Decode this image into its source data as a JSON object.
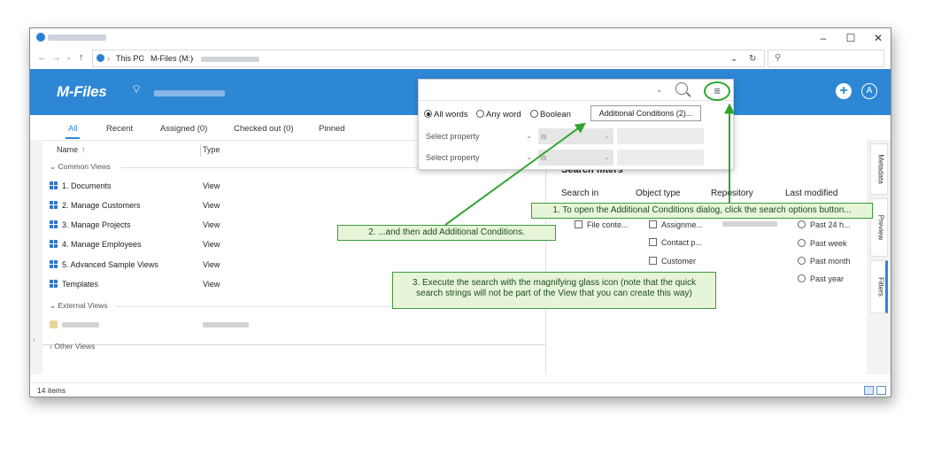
{
  "window": {
    "controls": {
      "minimize": "–",
      "maximize": "☐",
      "close": "✕"
    }
  },
  "address": {
    "back": "←",
    "forward": "→",
    "recent": "⌄",
    "up": "↑",
    "crumbs": [
      "This PC",
      "M-Files (M:)"
    ],
    "sep": "›",
    "dropdown": "⌄",
    "refresh": "↻",
    "search_glyph": "⚲"
  },
  "header": {
    "logo": "M-Files",
    "wifi_icon": "⌔",
    "plus": "+",
    "user": "A"
  },
  "search": {
    "caret": "⌄",
    "options_glyph": "≡",
    "modes": [
      {
        "label": "All words",
        "selected": true
      },
      {
        "label": "Any word",
        "selected": false
      },
      {
        "label": "Boolean",
        "selected": false
      }
    ],
    "additional_conditions": "Additional Conditions (2)...",
    "conditions": [
      {
        "property": "Select property",
        "operator": "is"
      },
      {
        "property": "Select property",
        "operator": "is"
      }
    ],
    "chev": "⌄"
  },
  "tabs": [
    "All",
    "Recent",
    "Assigned (0)",
    "Checked out (0)",
    "Pinned"
  ],
  "list": {
    "columns": {
      "name": "Name",
      "sort": "↑",
      "type": "Type"
    },
    "groups": {
      "common": "Common Views",
      "external": "External Views",
      "other": "Other Views"
    },
    "group_toggle": {
      "open": "⌄",
      "closed": "›"
    },
    "rows": [
      {
        "name": "1. Documents",
        "type": "View"
      },
      {
        "name": "2. Manage Customers",
        "type": "View"
      },
      {
        "name": "3. Manage Projects",
        "type": "View"
      },
      {
        "name": "4. Manage Employees",
        "type": "View"
      },
      {
        "name": "5. Advanced Sample Views",
        "type": "View"
      },
      {
        "name": "Templates",
        "type": "View"
      }
    ]
  },
  "filters": {
    "title": "Search filters",
    "headers": [
      "Search in",
      "Object type",
      "Repository",
      "Last modified"
    ],
    "search_in": [
      "File conte..."
    ],
    "object_type": [
      "Assignme...",
      "Contact p...",
      "Customer"
    ],
    "last_modified": [
      "Past 24 h...",
      "Past week",
      "Past month",
      "Past year"
    ]
  },
  "side_tabs": [
    "Metadata",
    "Preview",
    "Filters"
  ],
  "status": {
    "items": "14 items"
  },
  "callouts": {
    "step1": "1. To open the Additional Conditions dialog, click the search options button...",
    "step2": "2. ...and then add Additional Conditions.",
    "step3_line1": "3. Execute the search with the magnifying glass icon (note that the quick",
    "step3_line2": "search strings will not be part of the View that you can create this way)"
  },
  "colors": {
    "accent": "#2e87d4",
    "callout_bg": "#e6f5d8",
    "callout_border": "#3c9a3c",
    "arrow": "#2ea52e"
  }
}
